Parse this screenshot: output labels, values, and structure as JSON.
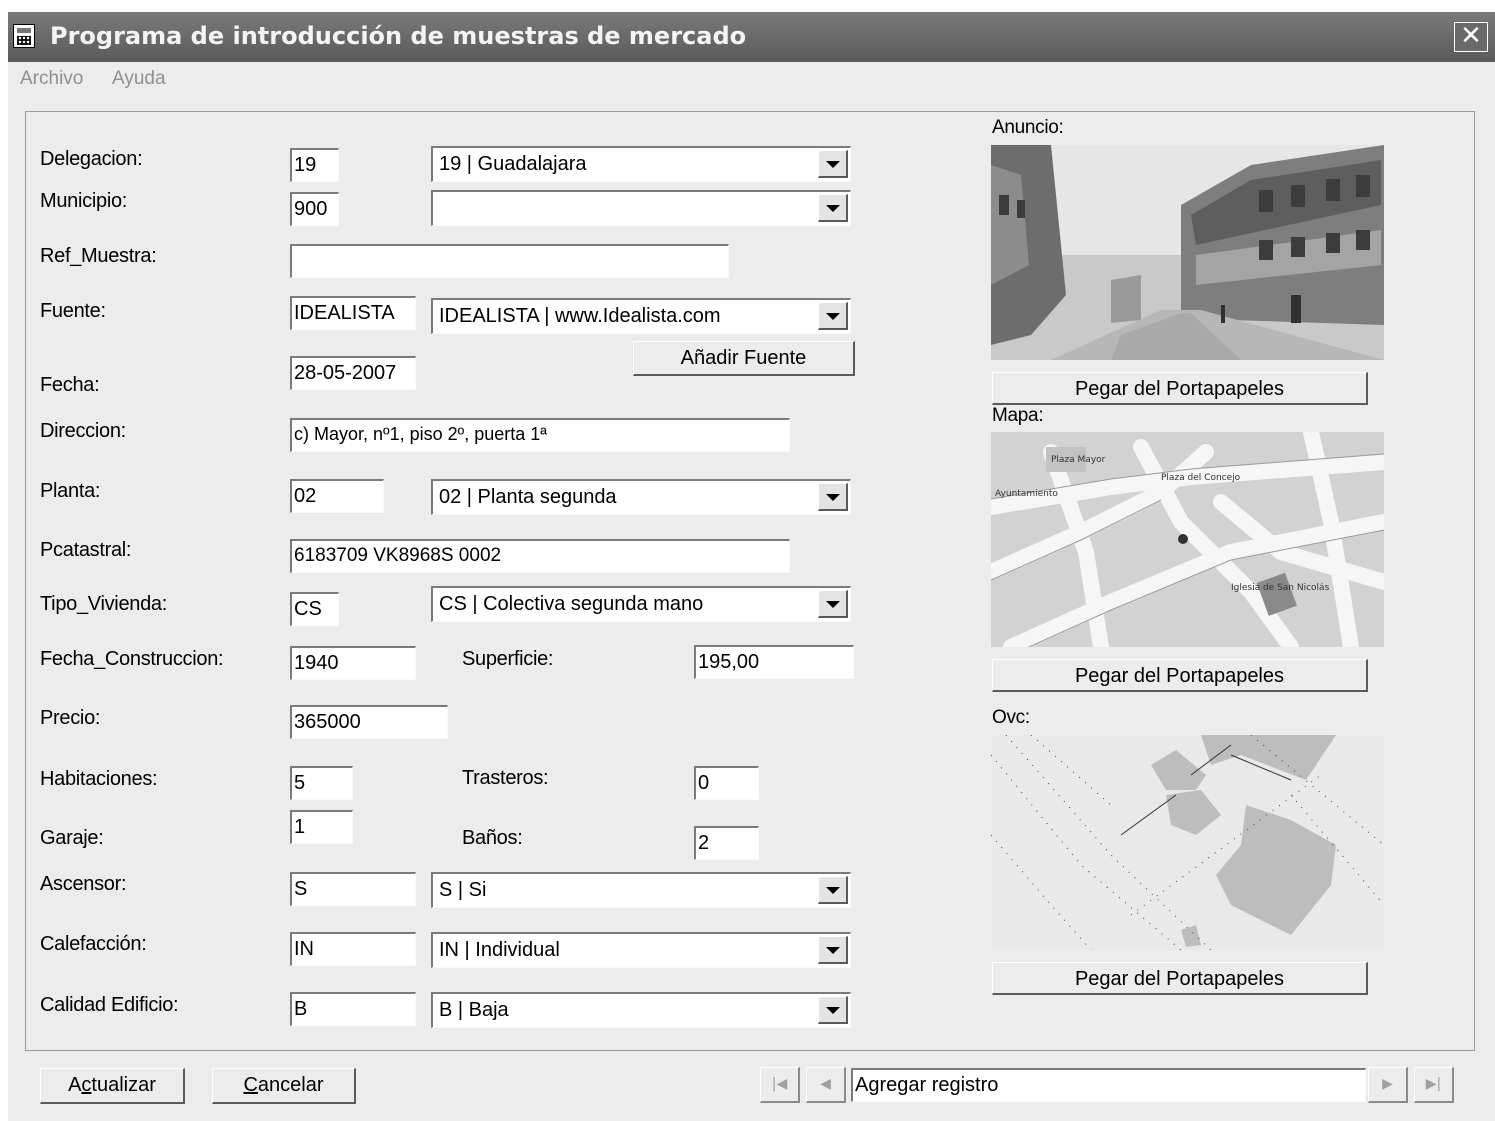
{
  "window": {
    "title": "Programa de introducción de muestras de mercado",
    "close_glyph": "✕"
  },
  "menu": {
    "items": [
      "Archivo",
      "Ayuda"
    ]
  },
  "form": {
    "delegacion": {
      "label": "Delegacion:",
      "code": "19",
      "select": "19  |  Guadalajara"
    },
    "municipio": {
      "label": "Municipio:",
      "code": "900",
      "select": ""
    },
    "ref_muestra": {
      "label": "Ref_Muestra:",
      "value": ""
    },
    "fuente": {
      "label": "Fuente:",
      "code": "IDEALISTA",
      "select": "IDEALISTA  |  www.Idealista.com",
      "add_button": "Añadir Fuente"
    },
    "fecha": {
      "label": "Fecha:",
      "value": "28-05-2007"
    },
    "direccion": {
      "label": "Direccion:",
      "value": "c) Mayor, nº1, piso 2º, puerta 1ª"
    },
    "planta": {
      "label": "Planta:",
      "code": "02",
      "select": "02  |  Planta segunda"
    },
    "pcatastral": {
      "label": "Pcatastral:",
      "value": "6183709 VK8968S 0002"
    },
    "tipo_vivienda": {
      "label": "Tipo_Vivienda:",
      "code": "CS",
      "select": "CS  |  Colectiva segunda mano"
    },
    "fecha_construccion": {
      "label": "Fecha_Construccion:",
      "value": "1940"
    },
    "superficie": {
      "label": "Superficie:",
      "value": "195,00"
    },
    "precio": {
      "label": "Precio:",
      "value": "365000"
    },
    "habitaciones": {
      "label": "Habitaciones:",
      "value": "5"
    },
    "trasteros": {
      "label": "Trasteros:",
      "value": "0"
    },
    "garaje": {
      "label": "Garaje:",
      "value": "1"
    },
    "banos": {
      "label": "Baños:",
      "value": "2"
    },
    "ascensor": {
      "label": "Ascensor:",
      "code": "S",
      "select": "S  |  Si"
    },
    "calefaccion": {
      "label": "Calefacción:",
      "code": "IN",
      "select": "IN  |  Individual"
    },
    "calidad_edificio": {
      "label": "Calidad Edificio:",
      "code": "B",
      "select": "B  |  Baja"
    }
  },
  "images": {
    "anuncio": {
      "label": "Anuncio:",
      "button": "Pegar del Portapapeles"
    },
    "mapa": {
      "label": "Mapa:",
      "button": "Pegar del Portapapeles",
      "map_text": [
        "Plaza Mayor",
        "Plaza del Concejo",
        "Ayuntamiento",
        "Iglesia de San Nicolás"
      ]
    },
    "ovc": {
      "label": "Ovc:",
      "button": "Pegar del Portapapeles"
    }
  },
  "footer": {
    "update_button_pre": "A",
    "update_button_key": "c",
    "update_button_post": "tualizar",
    "cancel_button_key": "C",
    "cancel_button_post": "ancelar",
    "record_text": "Agregar registro",
    "nav": {
      "first": "|◀",
      "prev": "◀",
      "next": "▶",
      "last": "▶|"
    }
  }
}
